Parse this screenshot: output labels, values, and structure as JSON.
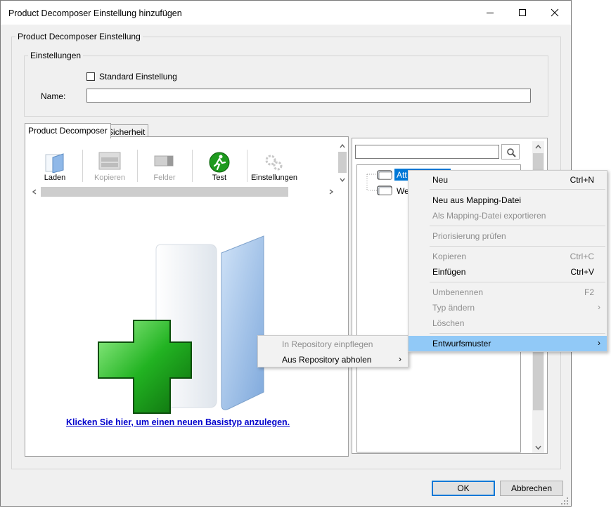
{
  "window": {
    "title": "Product Decomposer Einstellung hinzufügen"
  },
  "group_main": {
    "legend": "Product Decomposer Einstellung"
  },
  "group_settings": {
    "legend": "Einstellungen",
    "standard_checkbox_label": "Standard Einstellung",
    "standard_checked": false,
    "name_label": "Name:",
    "name_value": ""
  },
  "tabs": [
    {
      "label": "Product Decomposer",
      "active": true
    },
    {
      "label": "Sicherheit",
      "active": false
    }
  ],
  "toolbar": {
    "items": [
      {
        "label": "Laden",
        "enabled": true
      },
      {
        "label": "Kopieren",
        "enabled": false
      },
      {
        "label": "Felder",
        "enabled": false
      },
      {
        "label": "Test",
        "enabled": true
      },
      {
        "label": "Einstellungen",
        "enabled": true
      }
    ]
  },
  "empty_state": {
    "link_text": "Klicken Sie hier, um einen neuen Basistyp anzulegen."
  },
  "tree": {
    "search_value": "",
    "nodes": [
      {
        "label": "Att",
        "selected": true
      },
      {
        "label": "We",
        "selected": false
      }
    ]
  },
  "context_menu": {
    "items": [
      {
        "label": "Neu",
        "shortcut": "Ctrl+N",
        "enabled": true
      },
      {
        "label": "Neu aus Mapping-Datei",
        "shortcut": "",
        "enabled": true
      },
      {
        "label": "Als Mapping-Datei exportieren",
        "shortcut": "",
        "enabled": false
      },
      {
        "label": "Priorisierung prüfen",
        "shortcut": "",
        "enabled": false
      },
      {
        "label": "Kopieren",
        "shortcut": "Ctrl+C",
        "enabled": false
      },
      {
        "label": "Einfügen",
        "shortcut": "Ctrl+V",
        "enabled": true
      },
      {
        "label": "Umbenennen",
        "shortcut": "F2",
        "enabled": false
      },
      {
        "label": "Typ ändern",
        "shortcut": "",
        "enabled": false
      },
      {
        "label": "Löschen",
        "shortcut": "",
        "enabled": false
      },
      {
        "label": "Entwurfsmuster",
        "shortcut": "",
        "enabled": true,
        "highlighted": true
      }
    ],
    "submenu_arrow": "›"
  },
  "submenu": {
    "items": [
      {
        "label": "In Repository einpflegen",
        "enabled": false
      },
      {
        "label": "Aus Repository abholen",
        "enabled": true
      }
    ]
  },
  "buttons": {
    "ok": "OK",
    "cancel": "Abbrechen"
  },
  "colors": {
    "accent": "#0078d7",
    "selection": "#0078d7",
    "menu_highlight": "#91c9f7",
    "link": "#0000cc",
    "plus_green": "#22b322"
  }
}
